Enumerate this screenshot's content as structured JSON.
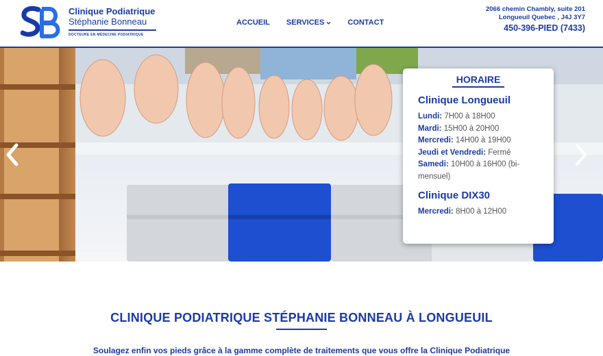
{
  "header": {
    "brand_name": "Clinique Podiatrique",
    "brand_person": "Stéphanie Bonneau",
    "brand_tagline": "DOCTEURE EN MÉDECINE PODIATRIQUE",
    "nav": [
      {
        "label": "ACCUEIL"
      },
      {
        "label": "SERVICES"
      },
      {
        "label": "CONTACT"
      }
    ],
    "address_line1": "2066 chemin Chambly, suite 201",
    "address_line2": "Longueuil Quebec , J4J 3Y7",
    "phone": "450-396-PIED (7433)"
  },
  "hero": {
    "schedule": {
      "title": "HORAIRE",
      "clinic1": {
        "name": "Clinique Longueuil",
        "hours": [
          {
            "day": "Lundi:",
            "time": " 7H00 à 18H00"
          },
          {
            "day": "Mardi:",
            "time": " 15H00 à 20H00"
          },
          {
            "day": "Mercredi:",
            "time": " 14H00 à 19H00"
          },
          {
            "day": "Jeudi et Vendredi:",
            "time": " Fermé"
          },
          {
            "day": "Samedi:",
            "time": " 10H00 à 16H00 (bi-"
          },
          {
            "day": "",
            "time": "mensuel)"
          }
        ]
      },
      "clinic2": {
        "name": "Clinique DIX30",
        "hours": [
          {
            "day": "Mercredi:",
            "time": " 8H00 à 12H00"
          }
        ]
      }
    }
  },
  "content": {
    "title": "CLINIQUE PODIATRIQUE STÉPHANIE BONNEAU À LONGUEUIL",
    "intro": "Soulagez enfin vos pieds grâce à la gamme complète de traitements que vous offre la Clinique Podiatrique"
  },
  "colors": {
    "brand_blue": "#1a3aa8",
    "chair_blue": "#1d4fd0"
  }
}
